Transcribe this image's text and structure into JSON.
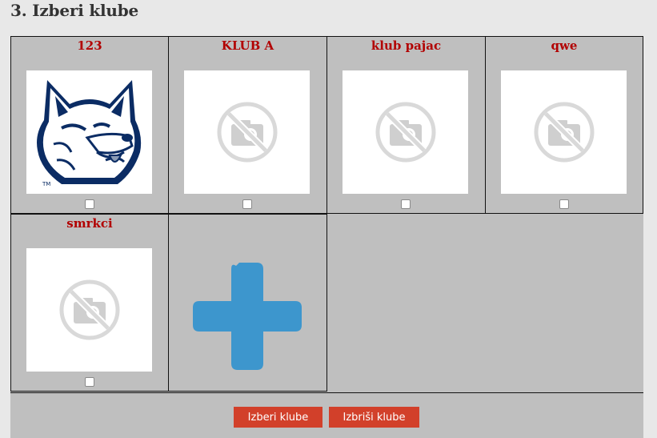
{
  "header": {
    "title": "3. Izberi klube"
  },
  "clubs": [
    {
      "name": "123",
      "image": "husky-logo",
      "selected": false
    },
    {
      "name": "KLUB A",
      "image": "no-photo-icon",
      "selected": false
    },
    {
      "name": "klub pajac",
      "image": "no-photo-icon",
      "selected": false
    },
    {
      "name": "qwe",
      "image": "no-photo-icon",
      "selected": false
    },
    {
      "name": "smrkci",
      "image": "no-photo-icon",
      "selected": false
    }
  ],
  "add_tile": {
    "icon": "plus-icon",
    "color": "#3d96cd"
  },
  "footer": {
    "select_label": "Izberi klube",
    "delete_label": "Izbriši klube"
  },
  "colors": {
    "club_name": "#b20000",
    "button": "#d2402a",
    "panel": "#bfbfbf",
    "background": "#e8e8e8"
  }
}
